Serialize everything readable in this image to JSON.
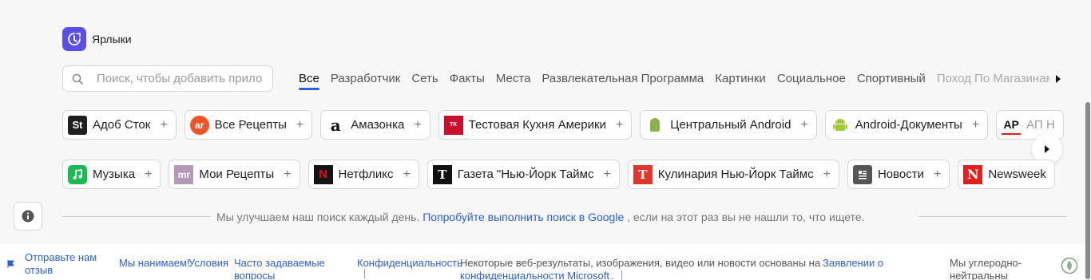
{
  "header": {
    "title": "Ярлыки"
  },
  "search": {
    "placeholder": "Поиск, чтобы добавить прило"
  },
  "tabs": [
    "Все",
    "Разработчик",
    "Сеть",
    "Факты",
    "Места",
    "Развлекательная Программа",
    "Картинки",
    "Социальное",
    "Спортивный",
    "Поход По Магазинам"
  ],
  "row1": [
    {
      "label": "Адоб Сток",
      "logo": "St",
      "color": "#1f1f1f"
    },
    {
      "label": "Все Рецепты",
      "logo": "ar",
      "color": "#f0552a"
    },
    {
      "label": "Амазонка",
      "logo": "a",
      "color": "#ffffff"
    },
    {
      "label": "Тестовая Кухня Америки",
      "logo": "TK",
      "color": "#c8102e"
    },
    {
      "label": "Центральный Android",
      "logo": "android-icon",
      "color": "#8fb04d"
    },
    {
      "label": "Android-Документы",
      "logo": "android-icon",
      "color": "#a4c639"
    },
    {
      "label": "АП Н",
      "logo": "AP",
      "color": "#ffffff"
    }
  ],
  "row2": [
    {
      "label": "Музыка",
      "logo": "music-icon",
      "color": "#1db954"
    },
    {
      "label": "Мои Рецепты",
      "logo": "mr",
      "color": "#b59ab8"
    },
    {
      "label": "Нетфликс",
      "logo": "N",
      "color": "#141414"
    },
    {
      "label": "Газета \"Нью-Йорк Таймс",
      "logo": "T",
      "color": "#111111"
    },
    {
      "label": "Кулинария Нью-Йорк Таймс",
      "logo": "T",
      "color": "#e0362c"
    },
    {
      "label": "Новости",
      "logo": "news-icon",
      "color": "#555555"
    },
    {
      "label": "Newsweek",
      "logo": "N",
      "color": "#e02020"
    }
  ],
  "notice": {
    "before": "Мы улучшаем наш поиск каждый день.",
    "link": "Попробуйте выполнить поиск в Google",
    "after": ", если на этот раз вы не нашли то, что ищете."
  },
  "footer": {
    "feedback_line1": "Отправьте нам",
    "feedback_line2": "отзыв",
    "hiring": "Мы нанимаем!",
    "terms": "Условия",
    "faq_line1": "Часто задаваемые",
    "faq_line2": "вопросы",
    "privacy": "Конфиденциальность",
    "disclaimer_line1": "Некоторые веб-результаты, изображения, видео или новости основаны на",
    "disclaimer_link1": "Заявлении о",
    "disclaimer_link2": "конфиденциальности Microsoft",
    "disclaimer_end": ".",
    "carbon_line1": "Мы углеродно-",
    "carbon_line2": "нейтральны"
  },
  "colors": {
    "accent": "#2b5fd9",
    "app_icon": "#5b4ee6"
  }
}
